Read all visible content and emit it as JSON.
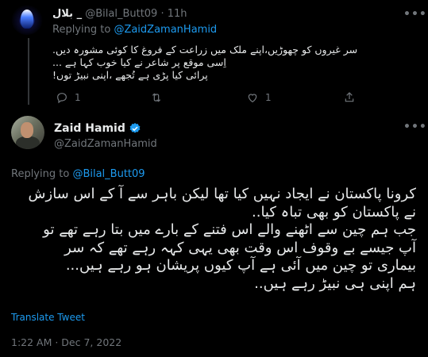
{
  "reply_tweet": {
    "display_name": "بلال _",
    "handle": "@Bilal_Butt09",
    "time": "11h",
    "replying_prefix": "Replying to",
    "replying_handle": "@ZaidZamanHamid",
    "lines": [
      "سر غیروں کو چھوڑیں،اپنے ملک میں زراعت کے فروغ کا کوئی مشورہ دیں.",
      "اِسی موقع پر شاعر نے کیا خوب کہا ہے ...",
      "پرائی کیا پڑی ہے تُجھے ،اپنی نبیڑ توں!"
    ],
    "actions": {
      "reply_icon": "reply-icon",
      "reply_count": "1",
      "retweet_icon": "retweet-icon",
      "like_icon": "heart-icon",
      "like_count": "1",
      "share_icon": "share-icon"
    }
  },
  "main_tweet": {
    "display_name": "Zaid Hamid",
    "handle": "@ZaidZamanHamid",
    "verified_icon": "verified-badge-icon",
    "replying_prefix": "Replying to",
    "replying_handle": "@Bilal_Butt09",
    "lines": [
      "کرونا پاکستان نے ایجاد نہیں کیا تھا لیکن باہر سے آ کے اس سازش",
      "نے پاکستان کو بھی تباہ کیا..",
      "جب ہم چین سے اٹھنے والے اس فتنے کے بارے میں بتا رہے تھے تو",
      "آپ جیسے بے وقوف اس وقت بھی یہی کہہ رہے تھے کہ سر",
      "بیماری تو چین میں آئی ہے آپ کیوں پریشان ہو رہے ہیں...",
      "ہم اپنی ہی نبیڑ رہے ہیں.."
    ],
    "translate_label": "Translate Tweet",
    "timestamp": "1:22 AM · Dec 7, 2022"
  },
  "more_icon": "more-options-icon",
  "colors": {
    "background": "#000000",
    "text": "#e7e9ea",
    "muted": "#71767b",
    "accent": "#1d9bf0"
  }
}
